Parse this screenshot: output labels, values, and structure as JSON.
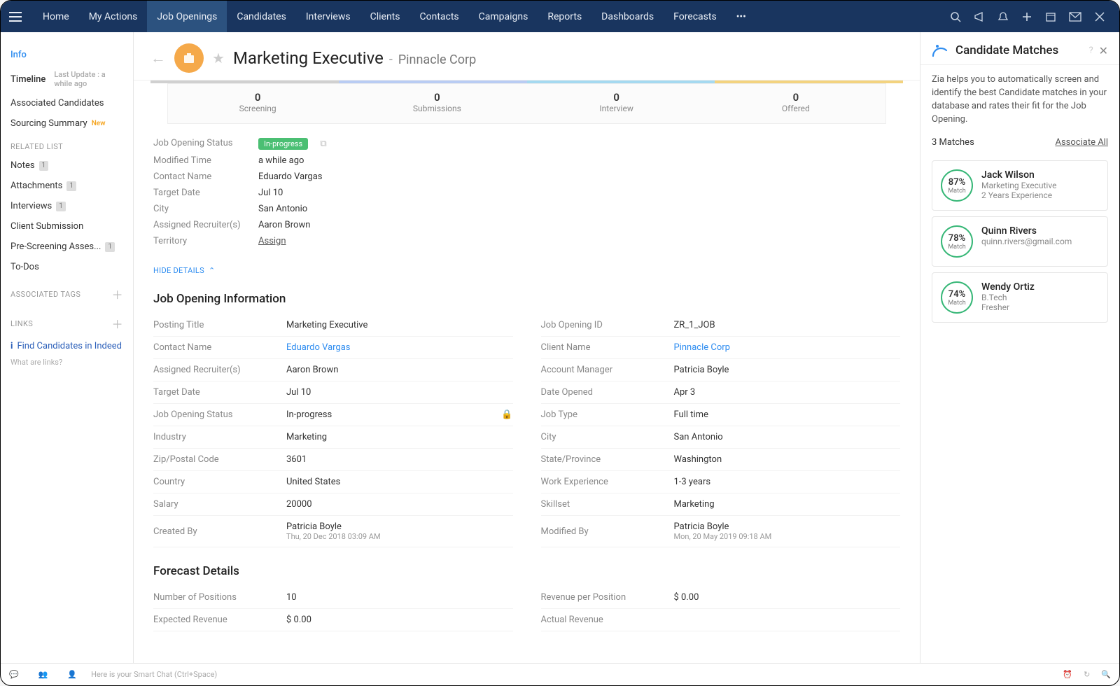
{
  "nav": {
    "tabs": [
      "Home",
      "My Actions",
      "Job Openings",
      "Candidates",
      "Interviews",
      "Clients",
      "Contacts",
      "Campaigns",
      "Reports",
      "Dashboards",
      "Forecasts"
    ],
    "active_index": 2
  },
  "sidebar": {
    "info": "Info",
    "timeline": "Timeline",
    "timeline_sub": "Last Update : a while ago",
    "assoc_cand": "Associated Candidates",
    "sourcing": "Sourcing Summary",
    "new_tag": "New",
    "related_list_hdr": "RELATED LIST",
    "notes": "Notes",
    "attachments": "Attachments",
    "interviews": "Interviews",
    "client_submission": "Client Submission",
    "prescreening": "Pre-Screening Asses...",
    "todos": "To-Dos",
    "assoc_tags_hdr": "ASSOCIATED TAGS",
    "links_hdr": "LINKS",
    "find_indeed": "Find Candidates in Indeed",
    "what_are_links": "What are links?",
    "count1": "1"
  },
  "header": {
    "title": "Marketing Executive",
    "sep": "-",
    "subtitle": "Pinnacle Corp"
  },
  "stats": [
    {
      "num": "0",
      "lbl": "Screening"
    },
    {
      "num": "0",
      "lbl": "Submissions"
    },
    {
      "num": "0",
      "lbl": "Interview"
    },
    {
      "num": "0",
      "lbl": "Offered"
    }
  ],
  "quick": {
    "jos_lbl": "Job Opening Status",
    "jos_val": "In-progress",
    "mt_lbl": "Modified Time",
    "mt_val": "a while ago",
    "cn_lbl": "Contact Name",
    "cn_val": "Eduardo Vargas",
    "td_lbl": "Target Date",
    "td_val": "Jul 10",
    "city_lbl": "City",
    "city_val": "San Antonio",
    "ar_lbl": "Assigned Recruiter(s)",
    "ar_val": "Aaron Brown",
    "terr_lbl": "Territory",
    "terr_val": "Assign"
  },
  "hide_details": "HIDE DETAILS",
  "section_job_info": "Job Opening Information",
  "job_info_left": [
    {
      "l": "Posting Title",
      "v": "Marketing Executive"
    },
    {
      "l": "Contact Name",
      "v": "Eduardo Vargas",
      "link": true
    },
    {
      "l": "Assigned Recruiter(s)",
      "v": "Aaron Brown"
    },
    {
      "l": "Target Date",
      "v": "Jul 10"
    },
    {
      "l": "Job Opening Status",
      "v": "In-progress",
      "lock": true
    },
    {
      "l": "Industry",
      "v": "Marketing"
    },
    {
      "l": "Zip/Postal Code",
      "v": "3601"
    },
    {
      "l": "Country",
      "v": "United States"
    },
    {
      "l": "Salary",
      "v": "20000"
    },
    {
      "l": "Created By",
      "v": "Patricia Boyle",
      "sub": "Thu, 20 Dec 2018 03:09 AM"
    }
  ],
  "job_info_right": [
    {
      "l": "Job Opening ID",
      "v": "ZR_1_JOB"
    },
    {
      "l": "Client Name",
      "v": "Pinnacle Corp",
      "link": true
    },
    {
      "l": "Account Manager",
      "v": "Patricia Boyle"
    },
    {
      "l": "Date Opened",
      "v": "Apr 3"
    },
    {
      "l": "Job Type",
      "v": "Full time"
    },
    {
      "l": "City",
      "v": "San Antonio"
    },
    {
      "l": "State/Province",
      "v": "Washington"
    },
    {
      "l": "Work Experience",
      "v": "1-3 years"
    },
    {
      "l": "Skillset",
      "v": "Marketing"
    },
    {
      "l": "Modified By",
      "v": "Patricia Boyle",
      "sub": "Mon, 20 May 2019 09:18 AM"
    }
  ],
  "section_forecast": "Forecast Details",
  "forecast_left": [
    {
      "l": "Number of Positions",
      "v": "10"
    },
    {
      "l": "Expected Revenue",
      "v": "$ 0.00"
    }
  ],
  "forecast_right": [
    {
      "l": "Revenue per Position",
      "v": "$ 0.00"
    },
    {
      "l": "Actual Revenue",
      "v": ""
    }
  ],
  "panel": {
    "zia": "Zia",
    "title": "Candidate Matches",
    "desc": "Zia helps you to automatically screen and identify the best Candidate matches in your database and rates their fit for the Job Opening.",
    "count": "3 Matches",
    "assoc_all": "Associate All",
    "matches": [
      {
        "pct": "87%",
        "name": "Jack Wilson",
        "l1": "Marketing Executive",
        "l2": "2 Years Experience"
      },
      {
        "pct": "78%",
        "name": "Quinn Rivers",
        "l1": "quinn.rivers@gmail.com",
        "l2": ""
      },
      {
        "pct": "74%",
        "name": "Wendy Ortiz",
        "l1": "B.Tech",
        "l2": "Fresher"
      }
    ],
    "match_lbl": "Match"
  },
  "footer": {
    "smart_chat": "Here is your Smart Chat (Ctrl+Space)"
  }
}
